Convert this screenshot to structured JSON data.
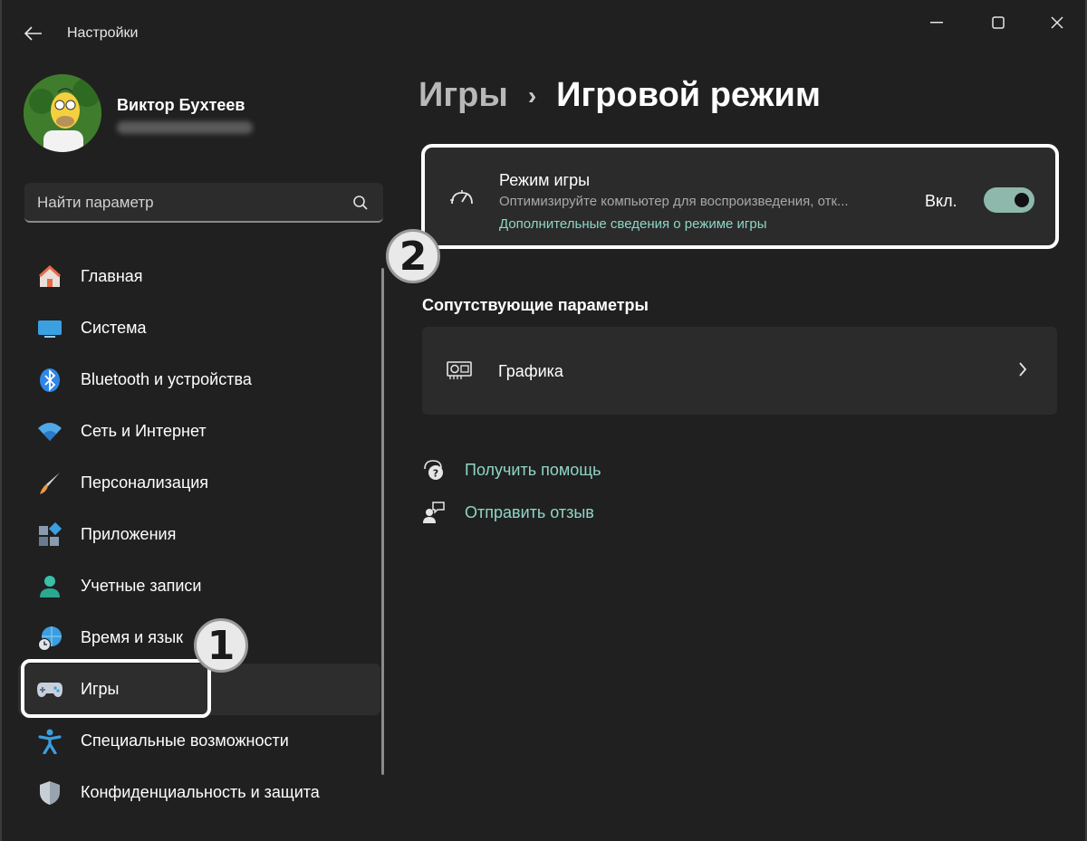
{
  "window": {
    "title": "Настройки"
  },
  "profile": {
    "name": "Виктор Бухтеев"
  },
  "search": {
    "placeholder": "Найти параметр"
  },
  "sidebar": {
    "items": [
      {
        "label": "Главная",
        "icon": "home-icon",
        "color": "#e8694a"
      },
      {
        "label": "Система",
        "icon": "display-icon",
        "color": "#3aa0e0"
      },
      {
        "label": "Bluetooth и устройства",
        "icon": "bluetooth-icon",
        "color": "#3a8ee6"
      },
      {
        "label": "Сеть и Интернет",
        "icon": "wifi-icon",
        "color": "#4fa8e8"
      },
      {
        "label": "Персонализация",
        "icon": "brush-icon",
        "color": "#e89a4a"
      },
      {
        "label": "Приложения",
        "icon": "apps-icon",
        "color": "#8a9bb0"
      },
      {
        "label": "Учетные записи",
        "icon": "account-icon",
        "color": "#3ac0a8"
      },
      {
        "label": "Время и язык",
        "icon": "globe-clock-icon",
        "color": "#3a9ee0"
      },
      {
        "label": "Игры",
        "icon": "gamepad-icon",
        "color": "#c0c8d8",
        "active": true
      },
      {
        "label": "Специальные возможности",
        "icon": "accessibility-icon",
        "color": "#3a9ee0"
      },
      {
        "label": "Конфиденциальность и защита",
        "icon": "shield-icon",
        "color": "#9aa4b0"
      }
    ]
  },
  "callouts": {
    "one": "1",
    "two": "2"
  },
  "breadcrumb": {
    "parent": "Игры",
    "separator": "›",
    "current": "Игровой режим"
  },
  "game_mode": {
    "title": "Режим игры",
    "description": "Оптимизируйте компьютер для воспроизведения, отк...",
    "link": "Дополнительные сведения о режиме игры",
    "state_label": "Вкл.",
    "enabled": true
  },
  "related": {
    "heading": "Сопутствующие параметры",
    "graphics_label": "Графика"
  },
  "footer_links": {
    "help": "Получить помощь",
    "feedback": "Отправить отзыв"
  },
  "colors": {
    "accent_link": "#8fd6c6",
    "toggle_on": "#8fb8ad",
    "background": "#202020",
    "card": "#2b2b2b"
  }
}
